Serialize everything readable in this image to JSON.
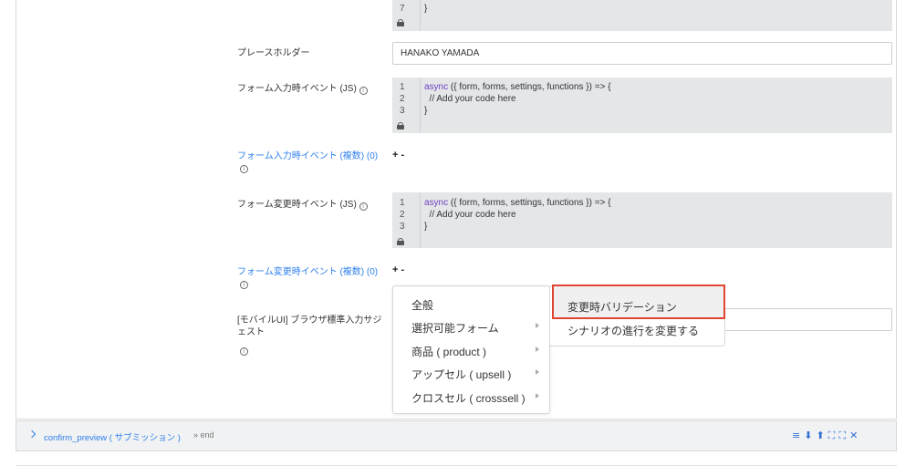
{
  "fields": {
    "top_code": {
      "line_number": "7",
      "line_text": "}"
    },
    "placeholder": {
      "label": "プレースホルダー",
      "value": "HANAKO YAMADA"
    },
    "on_input": {
      "label": "フォーム入力時イベント (JS)",
      "lines": [
        {
          "n": "1",
          "kw": "async",
          "rest": " ({ form, forms, settings, functions }) => {"
        },
        {
          "n": "2",
          "comment": "  // Add your code here"
        },
        {
          "n": "3",
          "rest": "}"
        }
      ]
    },
    "on_input_multi": {
      "label": "フォーム入力時イベント (複数) (0)",
      "plus": "+",
      "minus": "-"
    },
    "on_change": {
      "label": "フォーム変更時イベント (JS)",
      "lines": [
        {
          "n": "1",
          "kw": "async",
          "rest": " ({ form, forms, settings, functions }) => {"
        },
        {
          "n": "2",
          "comment": "  // Add your code here"
        },
        {
          "n": "3",
          "rest": "}"
        }
      ]
    },
    "on_change_multi": {
      "label": "フォーム変更時イベント (複数) (0)",
      "plus": "+",
      "minus": "-"
    },
    "mobile_suggest": {
      "label_line1": "[モバイルUI] ブラウザ標準入力サジ",
      "label_line2": "ェスト"
    }
  },
  "info_icon": "i",
  "menu": {
    "items": [
      {
        "label": "全般",
        "has_submenu": false
      },
      {
        "label": "選択可能フォーム",
        "has_submenu": true
      },
      {
        "label": "商品 ( product )",
        "has_submenu": true
      },
      {
        "label": "アップセル ( upsell )",
        "has_submenu": true
      },
      {
        "label": "クロスセル ( crosssell )",
        "has_submenu": true
      }
    ],
    "submenu": [
      {
        "label": "変更時バリデーション",
        "selected": true
      },
      {
        "label": "シナリオの進行を変更する",
        "selected": false
      }
    ]
  },
  "footer_bar": {
    "title": "confirm_preview ( サブミッション )",
    "end_label": "» end",
    "tools": {
      "menu": "≡",
      "down": "⬇",
      "up": "⬆",
      "collapse": "⛶",
      "expand": "⛶",
      "close": "✕"
    }
  },
  "colors": {
    "accent": "#2f80ed",
    "highlight_border": "#e0452f",
    "code_bg": "#e4e6e8"
  }
}
